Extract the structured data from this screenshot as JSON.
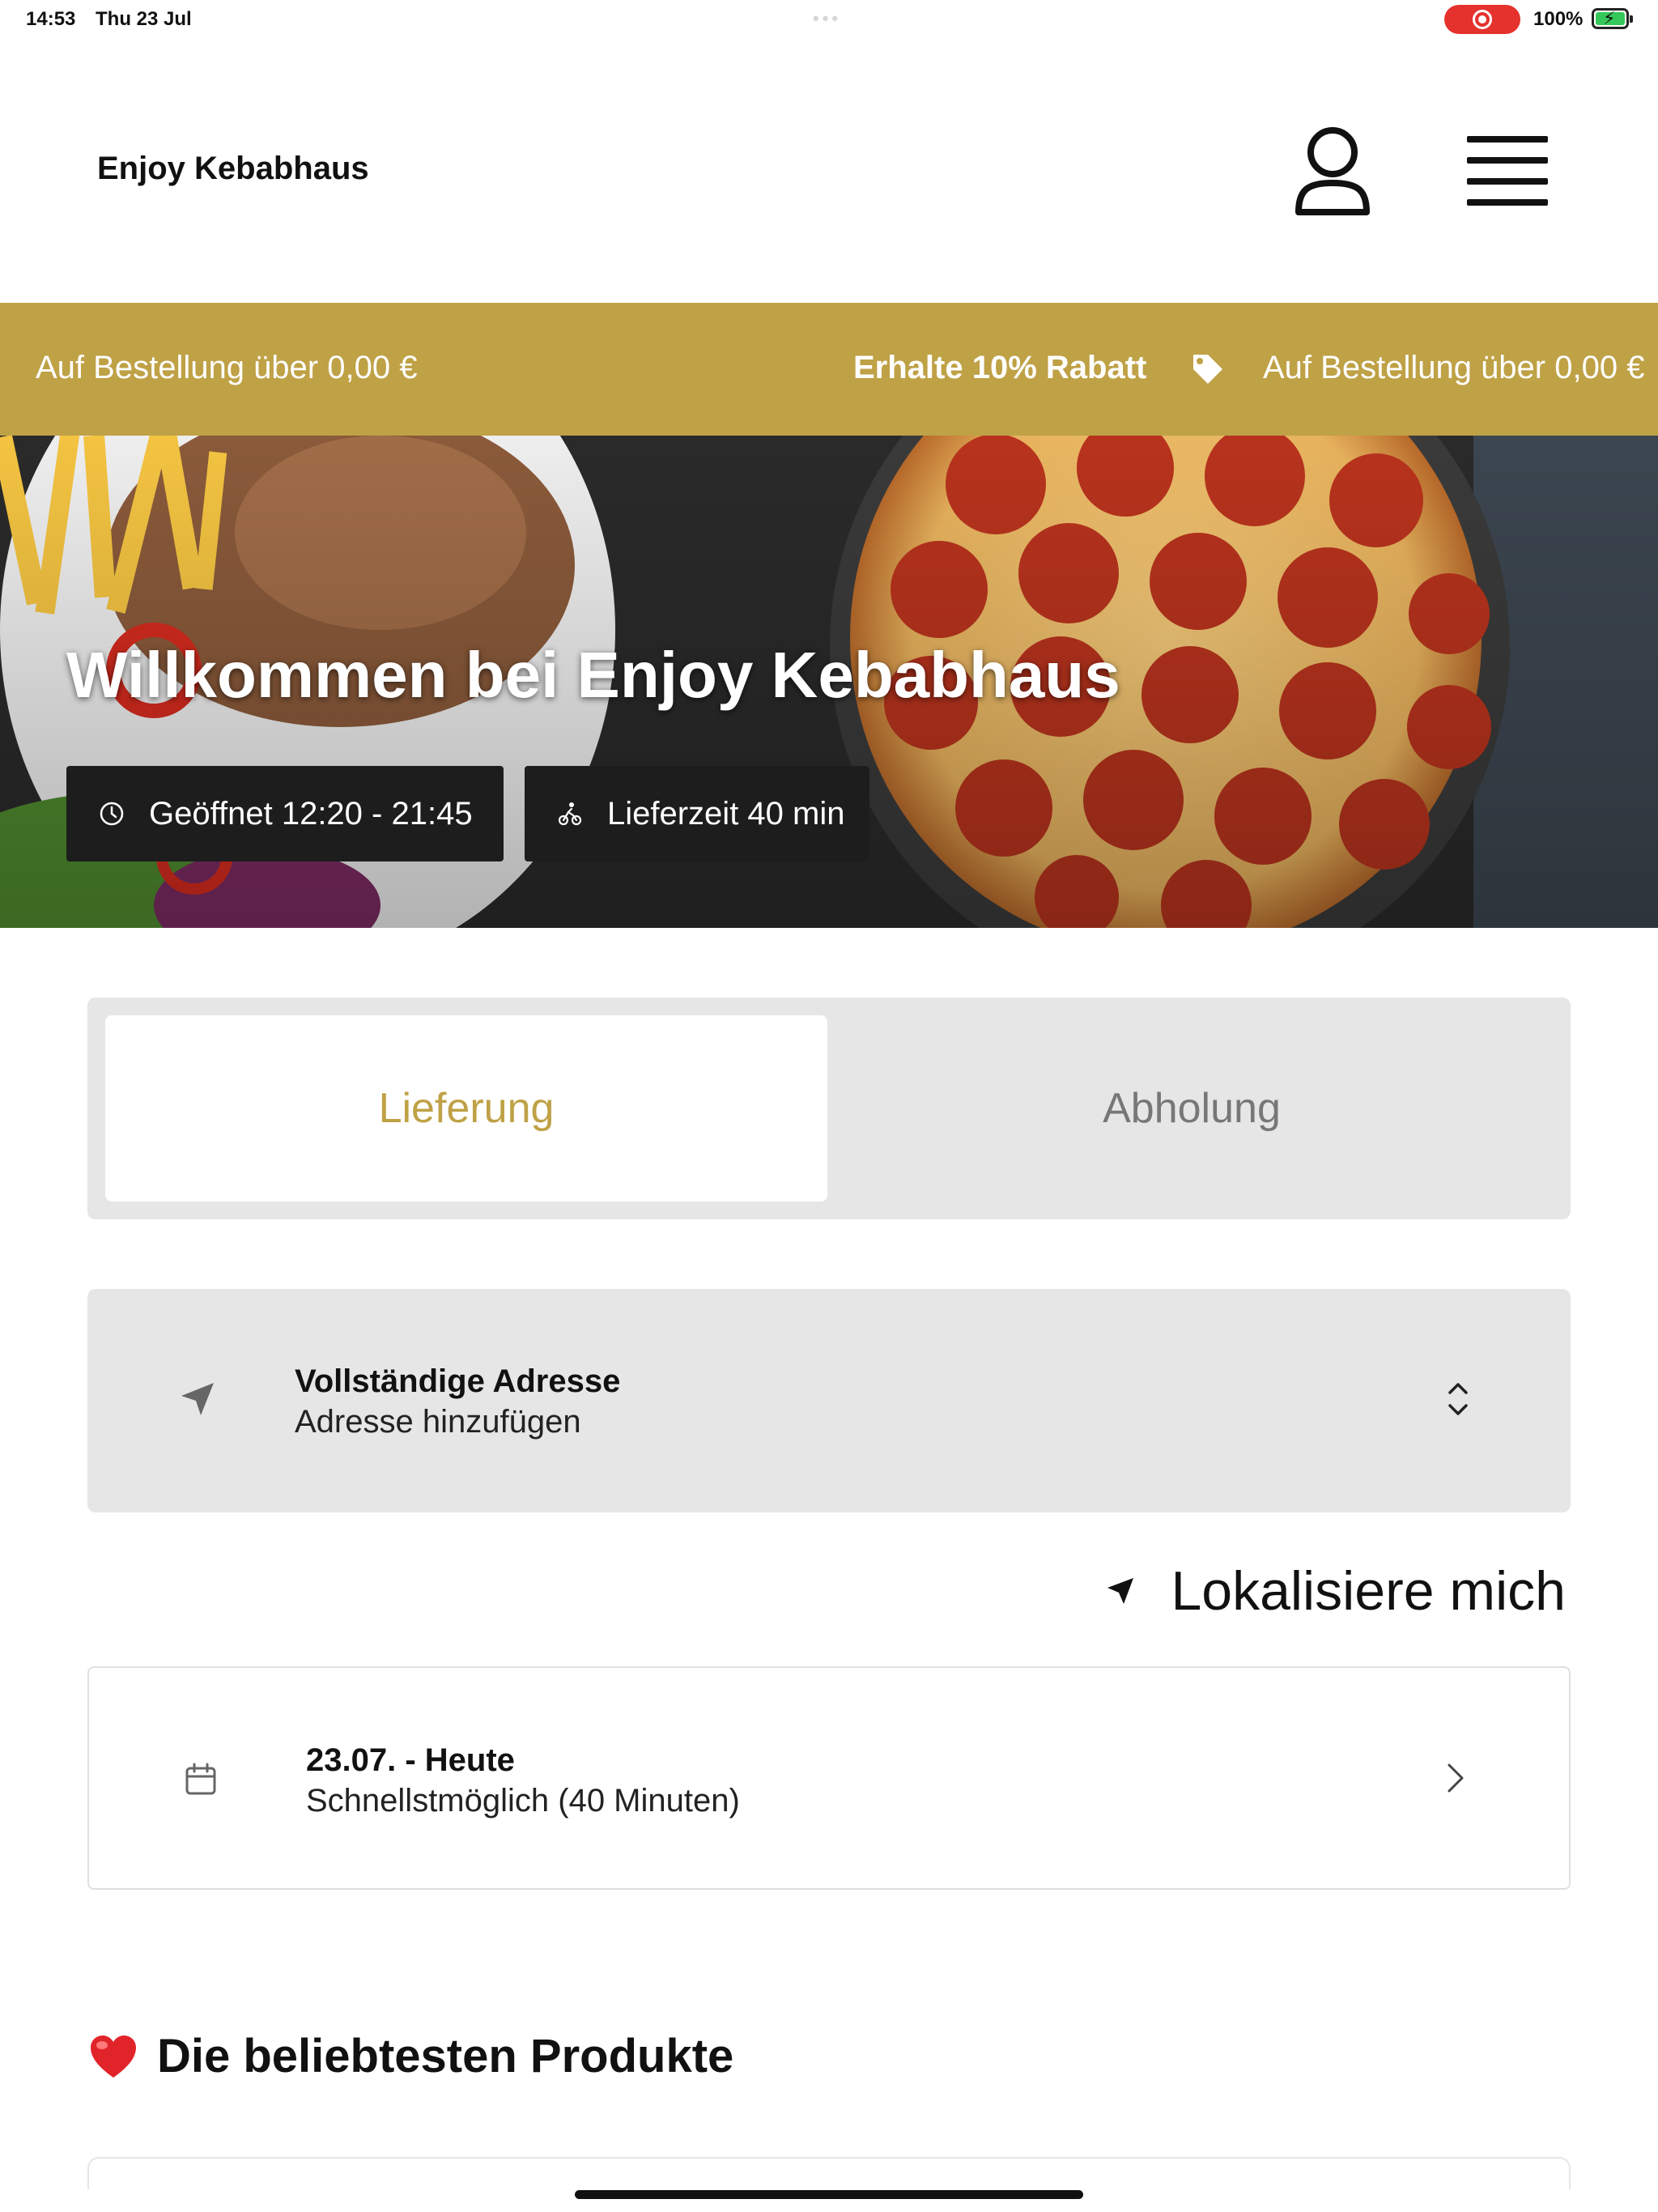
{
  "status_bar": {
    "time": "14:53",
    "date": "Thu 23 Jul",
    "battery": "100%"
  },
  "header": {
    "brand": "Enjoy Kebabhaus",
    "icons": [
      "user-icon",
      "menu-icon"
    ]
  },
  "promo": {
    "left_text": "Auf Bestellung über 0,00 €",
    "discount_text": "Erhalte 10% Rabatt",
    "right_text": "Auf Bestellung über 0,00 €",
    "background": "#bfa146"
  },
  "hero": {
    "title": "Willkommen bei Enjoy Kebabhaus",
    "open_hours": "Geöffnet 12:20 - 21:45",
    "delivery_time": "Lieferzeit 40 min"
  },
  "order_mode": {
    "options": [
      "Lieferung",
      "Abholung"
    ],
    "selected": "Lieferung",
    "accent": "#bfa146"
  },
  "address": {
    "title": "Vollständige Adresse",
    "subtitle": "Adresse hinzufügen"
  },
  "locate": {
    "label": "Lokalisiere mich"
  },
  "delivery_date": {
    "title": "23.07. - Heute",
    "subtitle": "Schnellstmöglich (40 Minuten)"
  },
  "popular": {
    "title": "Die beliebtesten Produkte"
  }
}
